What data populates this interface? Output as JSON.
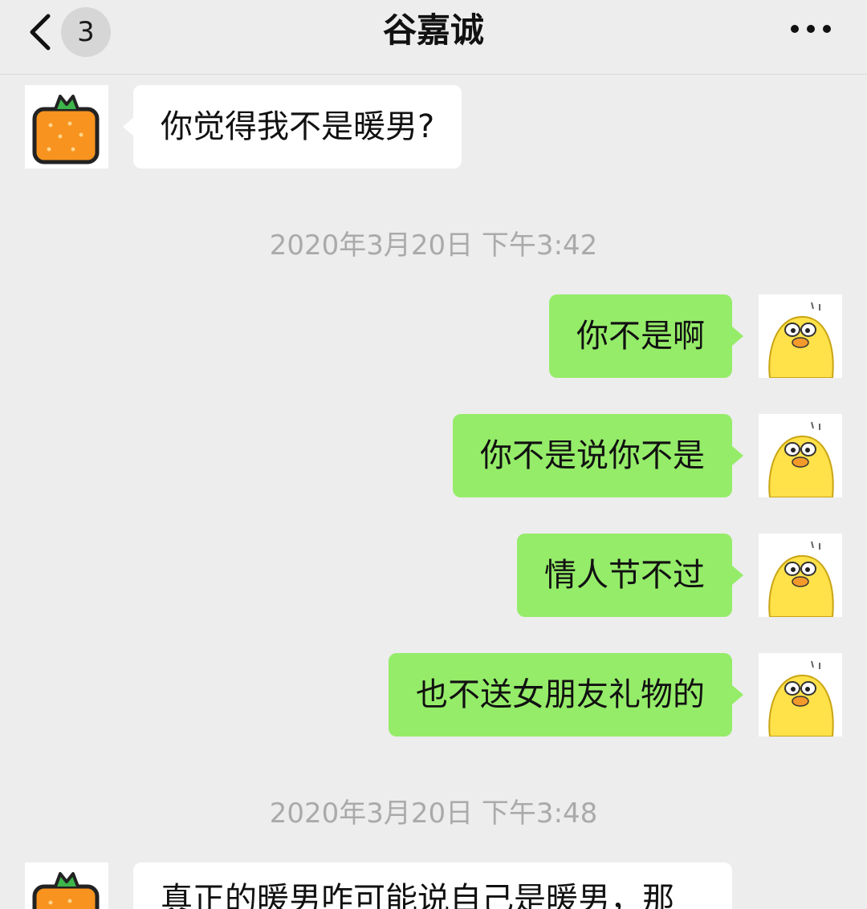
{
  "header": {
    "back_icon": "chevron-left-icon",
    "unread_count": "3",
    "title": "谷嘉诚",
    "more_icon": "ellipsis-icon"
  },
  "messages": [
    {
      "kind": "incoming",
      "text": "你觉得我不是暖男?",
      "avatar": "orange-avatar-icon"
    },
    {
      "kind": "timestamp",
      "text": "2020年3月20日 下午3:42"
    },
    {
      "kind": "outgoing",
      "text": "你不是啊",
      "avatar": "duck-avatar-icon"
    },
    {
      "kind": "outgoing",
      "text": "你不是说你不是",
      "avatar": "duck-avatar-icon"
    },
    {
      "kind": "outgoing",
      "text": "情人节不过",
      "avatar": "duck-avatar-icon"
    },
    {
      "kind": "outgoing",
      "text": "也不送女朋友礼物的",
      "avatar": "duck-avatar-icon"
    },
    {
      "kind": "timestamp",
      "text": "2020年3月20日 下午3:48"
    },
    {
      "kind": "incoming",
      "text": "真正的暖男咋可能说自己是暖男，那",
      "avatar": "orange-avatar-icon"
    }
  ],
  "colors": {
    "background": "#ededed",
    "outgoing_bubble": "#95ec69",
    "incoming_bubble": "#ffffff"
  }
}
